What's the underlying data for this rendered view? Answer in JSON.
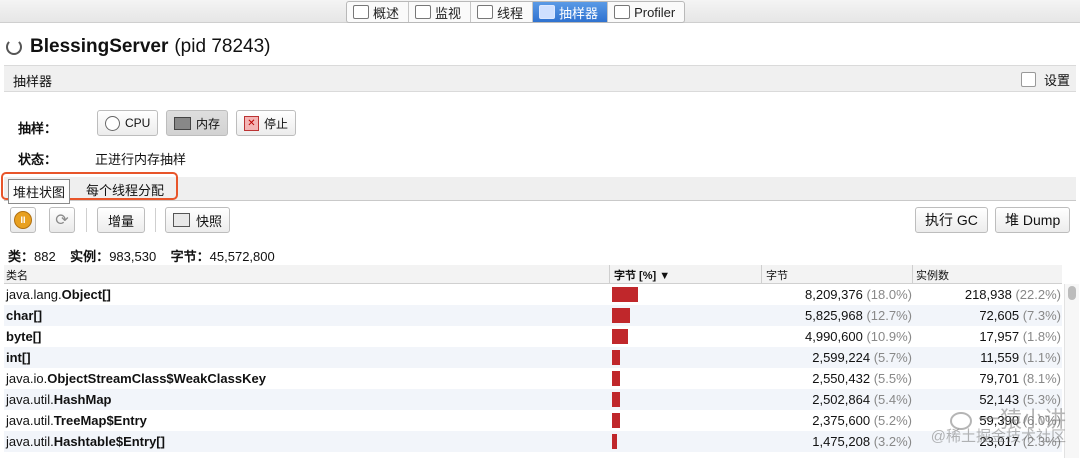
{
  "top_tabs": [
    {
      "label": "概述",
      "icon": "overview-icon"
    },
    {
      "label": "监视",
      "icon": "monitor-icon"
    },
    {
      "label": "线程",
      "icon": "threads-icon"
    },
    {
      "label": "抽样器",
      "icon": "sampler-icon",
      "active": true
    },
    {
      "label": "Profiler",
      "icon": "profiler-icon"
    }
  ],
  "app": {
    "name": "BlessingServer",
    "pid": "(pid 78243)"
  },
  "section": {
    "title": "抽样器",
    "settings_label": "设置"
  },
  "sample": {
    "label": "抽样：",
    "cpu_button": "CPU",
    "memory_button": "内存",
    "stop_button": "停止",
    "status_label": "状态：",
    "status_value": "正进行内存抽样"
  },
  "subtabs": {
    "histogram": "堆柱状图",
    "per_thread": "每个线程分配"
  },
  "toolbar": {
    "delta_button": "增量",
    "snapshot_button": "快照",
    "gc_button": "执行 GC",
    "heap_dump_button": "堆 Dump"
  },
  "stats": {
    "classes_label": "类：",
    "classes_value": "882",
    "instances_label": "实例：",
    "instances_value": "983,530",
    "bytes_label": "字节：",
    "bytes_value": "45,572,800"
  },
  "table": {
    "columns": [
      "类名",
      "字节 [%]",
      "字节",
      "实例数"
    ],
    "rows": [
      {
        "pkg": "java.lang.",
        "cls": "Object[]",
        "bytes": "8,209,376",
        "bytes_pct": "(18.0%)",
        "instances": "218,938",
        "inst_pct": "(22.2%)",
        "bar_pct": 18.0
      },
      {
        "pkg": "",
        "cls": "char[]",
        "bytes": "5,825,968",
        "bytes_pct": "(12.7%)",
        "instances": "72,605",
        "inst_pct": "(7.3%)",
        "bar_pct": 12.7
      },
      {
        "pkg": "",
        "cls": "byte[]",
        "bytes": "4,990,600",
        "bytes_pct": "(10.9%)",
        "instances": "17,957",
        "inst_pct": "(1.8%)",
        "bar_pct": 10.9
      },
      {
        "pkg": "",
        "cls": "int[]",
        "bytes": "2,599,224",
        "bytes_pct": "(5.7%)",
        "instances": "11,559",
        "inst_pct": "(1.1%)",
        "bar_pct": 5.7
      },
      {
        "pkg": "java.io.",
        "cls": "ObjectStreamClass$WeakClassKey",
        "bytes": "2,550,432",
        "bytes_pct": "(5.5%)",
        "instances": "79,701",
        "inst_pct": "(8.1%)",
        "bar_pct": 5.5
      },
      {
        "pkg": "java.util.",
        "cls": "HashMap",
        "bytes": "2,502,864",
        "bytes_pct": "(5.4%)",
        "instances": "52,143",
        "inst_pct": "(5.3%)",
        "bar_pct": 5.4
      },
      {
        "pkg": "java.util.",
        "cls": "TreeMap$Entry",
        "bytes": "2,375,600",
        "bytes_pct": "(5.2%)",
        "instances": "59,390",
        "inst_pct": "(6.0%)",
        "bar_pct": 5.2
      },
      {
        "pkg": "java.util.",
        "cls": "Hashtable$Entry[]",
        "bytes": "1,475,208",
        "bytes_pct": "(3.2%)",
        "instances": "23,017",
        "inst_pct": "(2.3%)",
        "bar_pct": 3.2
      }
    ]
  },
  "watermark": {
    "line1": "一猿小讲",
    "line2": "@稀土掘金技术社区"
  },
  "colors": {
    "bar": "#c0272b",
    "active_tab": "#2f72d0",
    "highlight": "#e8552a"
  }
}
